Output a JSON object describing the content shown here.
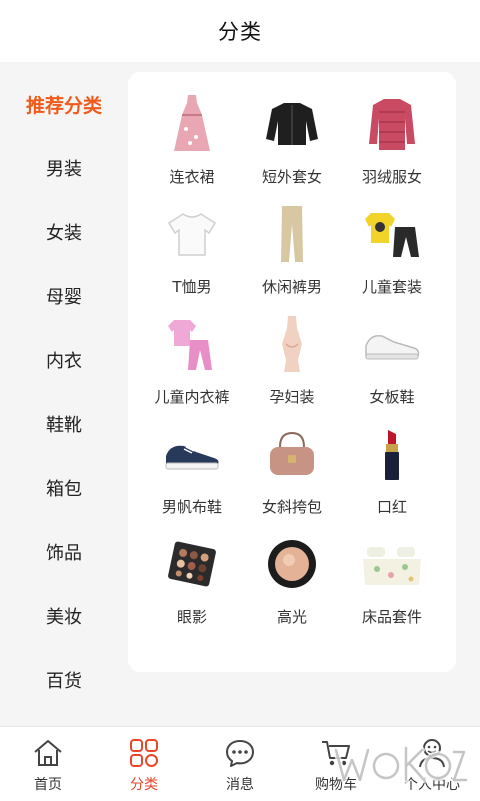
{
  "header": {
    "title": "分类"
  },
  "sidebar": {
    "items": [
      {
        "label": "推荐分类",
        "active": true
      },
      {
        "label": "男装"
      },
      {
        "label": "女装"
      },
      {
        "label": "母婴"
      },
      {
        "label": "内衣"
      },
      {
        "label": "鞋靴"
      },
      {
        "label": "箱包"
      },
      {
        "label": "饰品"
      },
      {
        "label": "美妆"
      },
      {
        "label": "百货"
      }
    ]
  },
  "categories": [
    {
      "label": "连衣裙",
      "icon": "dress-icon"
    },
    {
      "label": "短外套女",
      "icon": "short-jacket-icon"
    },
    {
      "label": "羽绒服女",
      "icon": "down-jacket-icon"
    },
    {
      "label": "T恤男",
      "icon": "tshirt-icon"
    },
    {
      "label": "休闲裤男",
      "icon": "casual-pants-icon"
    },
    {
      "label": "儿童套装",
      "icon": "kids-set-icon"
    },
    {
      "label": "儿童内衣裤",
      "icon": "kids-underwear-icon"
    },
    {
      "label": "孕妇装",
      "icon": "maternity-dress-icon"
    },
    {
      "label": "女板鞋",
      "icon": "sneaker-icon"
    },
    {
      "label": "男帆布鞋",
      "icon": "canvas-shoe-icon"
    },
    {
      "label": "女斜挎包",
      "icon": "crossbody-bag-icon"
    },
    {
      "label": "口红",
      "icon": "lipstick-icon"
    },
    {
      "label": "眼影",
      "icon": "eyeshadow-icon"
    },
    {
      "label": "高光",
      "icon": "highlighter-icon"
    },
    {
      "label": "床品套件",
      "icon": "bedding-icon"
    }
  ],
  "tabbar": {
    "items": [
      {
        "label": "首页",
        "icon": "home-icon"
      },
      {
        "label": "分类",
        "icon": "category-icon",
        "active": true
      },
      {
        "label": "消息",
        "icon": "message-icon"
      },
      {
        "label": "购物车",
        "icon": "cart-icon"
      },
      {
        "label": "个人中心",
        "icon": "user-icon"
      }
    ]
  },
  "colors": {
    "accent": "#f05a1a",
    "tab_active": "#e8472a"
  }
}
